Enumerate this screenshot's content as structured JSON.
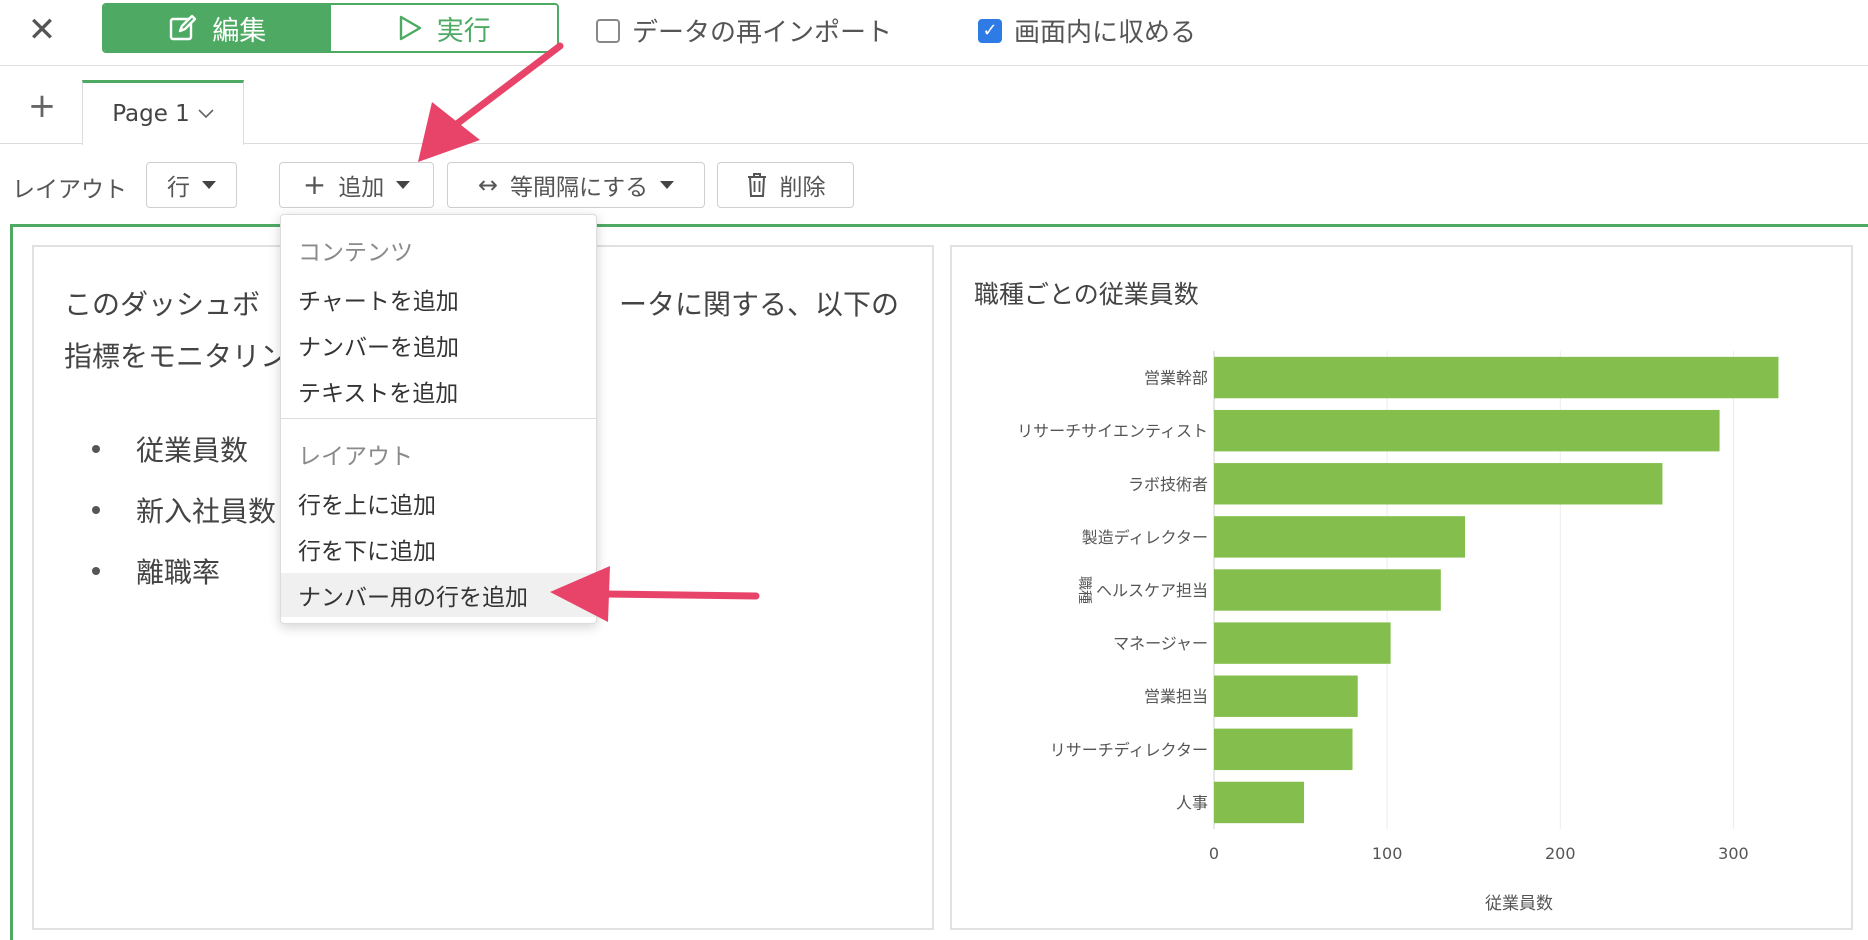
{
  "topbar": {
    "close_icon": "close-icon",
    "edit_label": "編集",
    "run_label": "実行",
    "reimport_label": "データの再インポート",
    "reimport_checked": false,
    "fit_label": "画面内に収める",
    "fit_checked": true
  },
  "tabs": {
    "add_symbol": "+",
    "page_label": "Page 1"
  },
  "toolbar": {
    "layout_label": "レイアウト",
    "row_label": "行",
    "add_label": "追加",
    "equal_label": "等間隔にする",
    "equal_symbol": "↔",
    "delete_label": "削除"
  },
  "menu": {
    "section_contents": "コンテンツ",
    "add_chart": "チャートを追加",
    "add_number": "ナンバーを追加",
    "add_text": "テキストを追加",
    "section_layout": "レイアウト",
    "add_row_above": "行を上に追加",
    "add_row_below": "行を下に追加",
    "add_number_row": "ナンバー用の行を追加"
  },
  "text_panel": {
    "intro_left": "このダッシュボ",
    "intro_right": "ータに関する、以下の",
    "intro_line2": "指標をモニタリン",
    "bullets": [
      "従業員数",
      "新入社員数",
      "離職率"
    ]
  },
  "chart_data": {
    "type": "bar",
    "orientation": "horizontal",
    "title": "職種ごとの従業員数",
    "categories": [
      "営業幹部",
      "リサーチサイエンティスト",
      "ラボ技術者",
      "製造ディレクター",
      "ヘルスケア担当",
      "マネージャー",
      "営業担当",
      "リサーチディレクター",
      "人事"
    ],
    "values": [
      326,
      292,
      259,
      145,
      131,
      102,
      83,
      80,
      52
    ],
    "xlabel": "従業員数",
    "ylabel": "職種",
    "xlim": [
      0,
      350
    ],
    "xticks": [
      0,
      100,
      200,
      300
    ],
    "bar_color": "#84bf4d",
    "grid": true
  },
  "colors": {
    "accent": "#4eaa63",
    "annotation_arrow": "#e8446a",
    "checkbox": "#2f7be5"
  }
}
